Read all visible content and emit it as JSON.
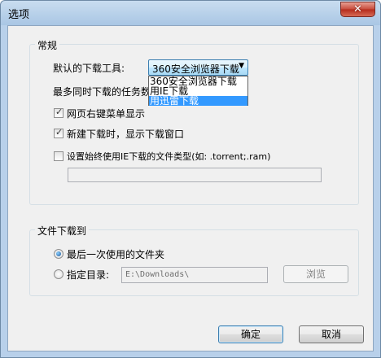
{
  "window": {
    "title": "选项",
    "close_glyph": "✕"
  },
  "general": {
    "group_title": "常规",
    "downloader_label": "默认的下载工具:",
    "downloader_selected": "360安全浏览器下载",
    "downloader_options": [
      "360安全浏览器下载",
      "用IE下载",
      "用迅雷下载"
    ],
    "downloader_highlighted_index": 2,
    "max_tasks_label": "最多同时下载的任务数",
    "checkbox_context_menu": "网页右键菜单显示",
    "checkbox_show_window": "新建下载时，显示下载窗口",
    "checkbox_ie_filetypes": "设置始终使用IE下载的文件类型(如: .torrent;.ram)",
    "filetypes_value": ""
  },
  "file_download": {
    "group_title": "文件下载到",
    "radio_last_folder": "最后一次使用的文件夹",
    "radio_specified": "指定目录:",
    "path_value": "E:\\Downloads\\",
    "browse_label": "浏览"
  },
  "buttons": {
    "ok": "确定",
    "cancel": "取消"
  },
  "icons": {
    "close": "close-icon",
    "dropdown": "chevron-down-icon",
    "check": "checkmark-icon"
  },
  "colors": {
    "selection": "#3399ff",
    "titlebar": "#b8d0ea",
    "dialog_bg": "#f0f0f0"
  }
}
